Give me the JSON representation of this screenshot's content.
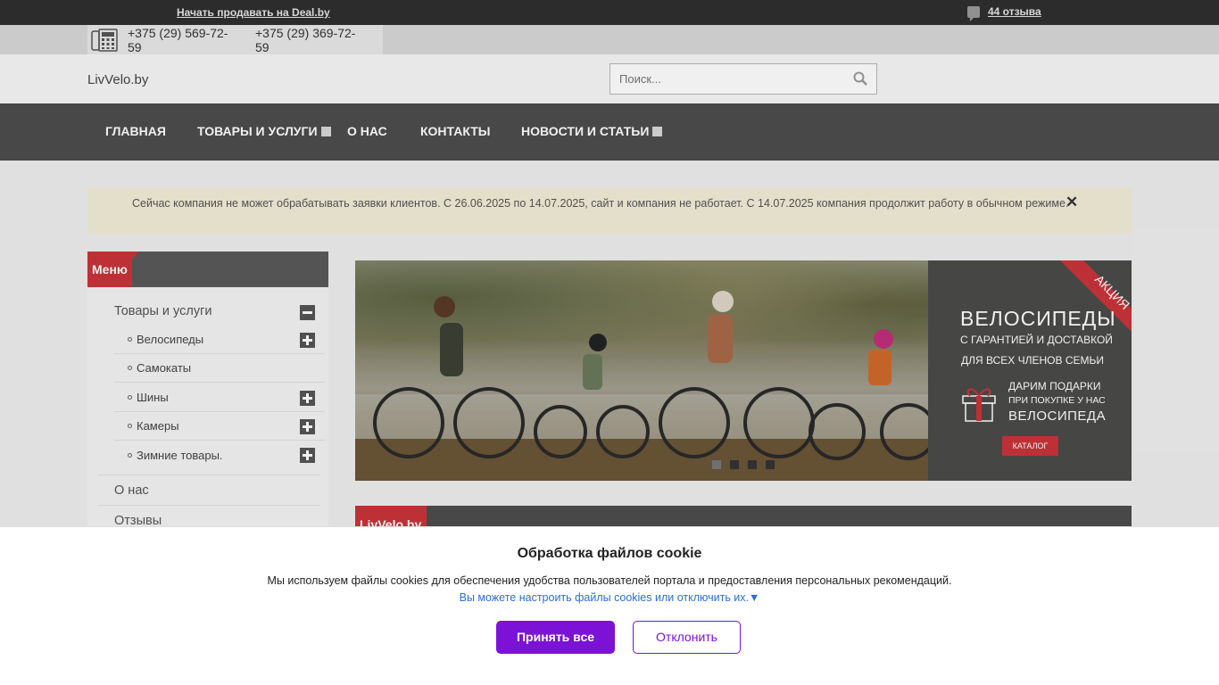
{
  "topbar": {
    "sell_link": "Начать продавать на Deal.by",
    "reviews_link": "44 отзыва"
  },
  "phones": [
    "+375 (29) 569-72-59",
    "+375 (29) 369-72-59"
  ],
  "header": {
    "logo": "LivVelo.by",
    "search_placeholder": "Поиск..."
  },
  "nav": {
    "items": [
      "ГЛАВНАЯ",
      "ТОВАРЫ И УСЛУГИ",
      "О НАС",
      "КОНТАКТЫ",
      "НОВОСТИ И СТАТЬИ"
    ]
  },
  "notice": {
    "text": "Сейчас компания не может обрабатывать заявки клиентов. С 26.06.2025 по 14.07.2025, сайт и компания не работает. С 14.07.2025 компания продолжит работу в обычном режиме.",
    "close": "✕"
  },
  "sidebar": {
    "title": "Меню",
    "items": [
      "Товары и услуги",
      "О нас",
      "Отзывы"
    ],
    "subitems": [
      "Велосипеды",
      "Самокаты",
      "Шины",
      "Камеры",
      "Зимние товары."
    ]
  },
  "banner": {
    "ribbon": "АКЦИЯ",
    "title": "ВЕЛОСИПЕДЫ",
    "line1": "С ГАРАНТИЕЙ И ДОСТАВКОЙ",
    "line2": "ДЛЯ ВСЕХ ЧЛЕНОВ СЕМЬИ",
    "gift1": "ДАРИМ ПОДАРКИ",
    "gift2": "ПРИ ПОКУПКЕ У НАС",
    "gift3": "ВЕЛОСИПЕДА",
    "button": "КАТАЛОГ"
  },
  "content": {
    "tab": "LivVelo.by"
  },
  "cookie": {
    "title": "Обработка файлов cookie",
    "message": "Мы используем файлы cookies для обеспечения удобства пользователей портала и предоставления персональных рекомендаций.",
    "settings_link": "Вы можете настроить файлы cookies или отключить их.▼",
    "accept": "Принять все",
    "reject": "Отклонить"
  },
  "colors": {
    "accent_red": "#c9353a",
    "nav_bg": "#4d4d4d",
    "cookie_purple": "#7b12d6"
  }
}
